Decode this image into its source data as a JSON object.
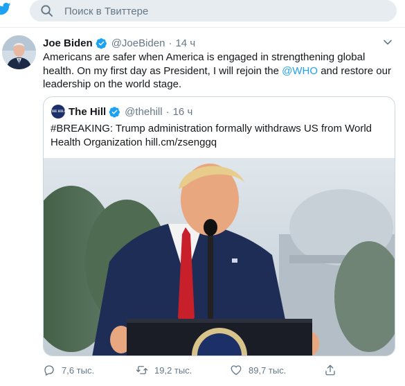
{
  "search": {
    "placeholder": "Поиск в Твиттере"
  },
  "tweet": {
    "author_name": "Joe Biden",
    "handle": "@JoeBiden",
    "separator": "·",
    "time": "14 ч",
    "text_before": "Americans are safer when America is engaged in strengthening global health. On my first day as President, I will rejoin the ",
    "mention": "@WHO",
    "text_after": " and restore our leadership on the world stage."
  },
  "quote": {
    "author_name": "The Hill",
    "handle": "@thehill",
    "separator": "·",
    "time": "16 ч",
    "logo_text": "THE HILL",
    "text": "#BREAKING: Trump administration formally withdraws US from World Health Organization hill.cm/zsenggq"
  },
  "actions": {
    "reply_count": "7,6 тыс.",
    "retweet_count": "19,2 тыс.",
    "like_count": "89,7 тыс."
  },
  "colors": {
    "accent": "#1da1f2",
    "text": "#14171a",
    "secondary": "#657786",
    "border": "#e6ecf0"
  }
}
